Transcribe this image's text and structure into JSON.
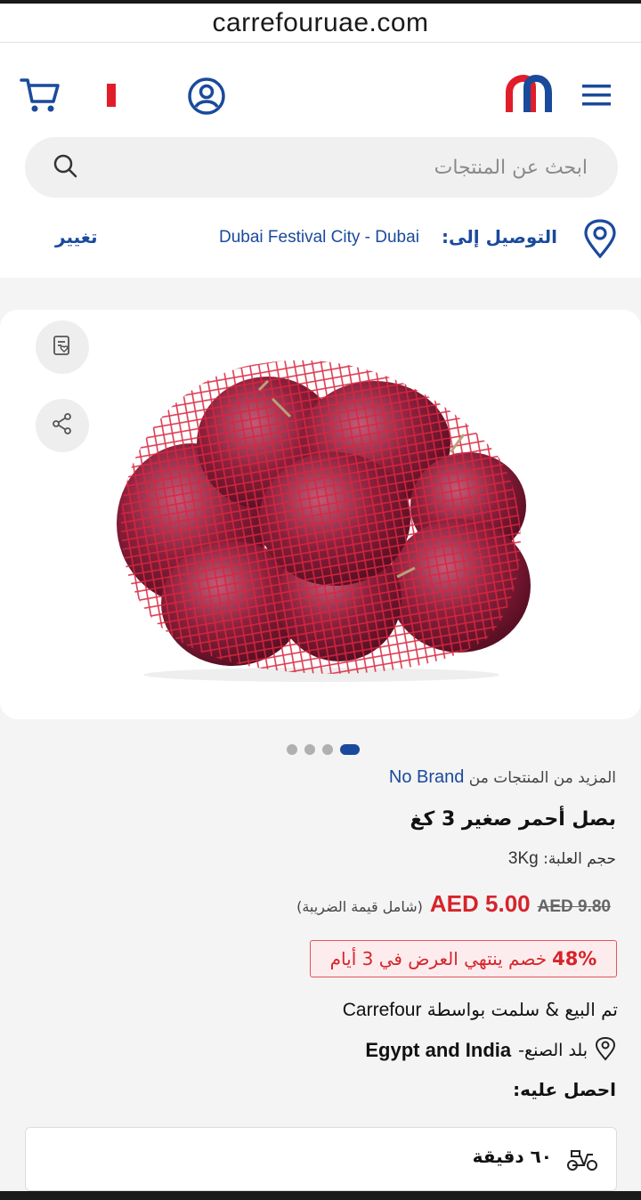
{
  "browser": {
    "url": "carrefouruae.com"
  },
  "header": {
    "icons": [
      "cart-icon",
      "uae-flag-icon",
      "account-icon",
      "carrefour-logo",
      "hamburger-menu-icon"
    ],
    "search_placeholder": "ابحث عن المنتجات",
    "delivery_label": "التوصيل إلى:",
    "delivery_location": "Dubai Festival City - Dubai",
    "change_label": "تغيير"
  },
  "gallery": {
    "image_count": 4,
    "active_index": 3
  },
  "product": {
    "brand_prefix": "المزيد من المنتجات من",
    "brand": "No Brand",
    "title": "بصل أحمر صغير 3 كغ",
    "pack_label": "حجم العلبة:",
    "pack_value": "3Kg",
    "price_new": "AED 5.00",
    "price_old": "AED 9.80",
    "vat_note": "(شامل قيمة الضريبة)",
    "promo_pct": "48%",
    "promo_text": "خصم ينتهي العرض في 3 أيام",
    "sold_by_label": "تم البيع & سلمت بواسطة",
    "seller": "Carrefour",
    "origin_label": "بلد الصنع-",
    "origin_value": "Egypt and India",
    "get_it_label": "احصل عليه:",
    "delivery_time": "٦٠ دقيقة"
  },
  "colors": {
    "brand_blue": "#1a4a9c",
    "sale_red": "#d6242b"
  }
}
